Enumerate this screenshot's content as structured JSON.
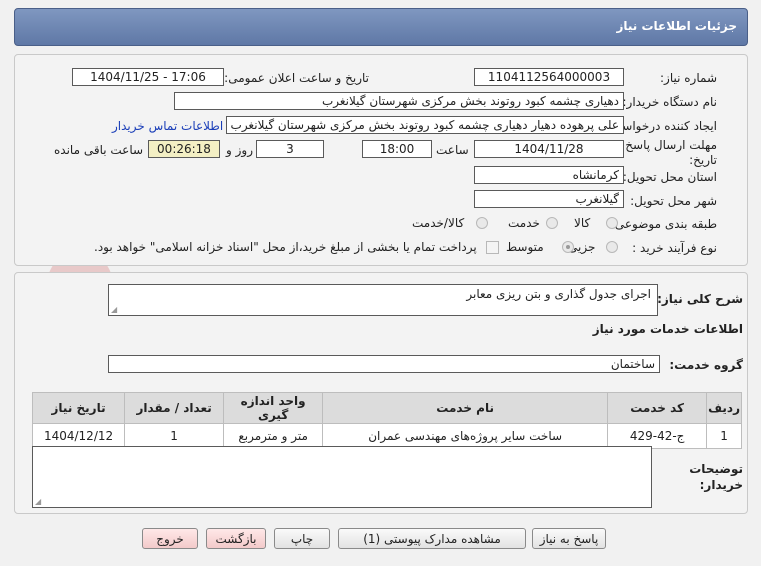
{
  "header": {
    "title": "جزئیات اطلاعات نیاز"
  },
  "form": {
    "need_number_label": "شماره نیاز:",
    "need_number": "1104112564000003",
    "announce_label": "تاریخ و ساعت اعلان عمومی:",
    "announce_value": "1404/11/25 - 17:06",
    "buyer_org_label": "نام دستگاه خریدار:",
    "buyer_org": "دهیاری چشمه کبود روتوند بخش مرکزی شهرستان گیلانغرب",
    "requester_label": "ایجاد کننده درخواست:",
    "requester": "علی پرهوده دهیار دهیاری چشمه کبود روتوند بخش مرکزی شهرستان گیلانغرب",
    "contact_link": "اطلاعات تماس خریدار",
    "deadline_label_1": "مهلت ارسال پاسخ: تا",
    "deadline_label_2": "تاریخ:",
    "deadline_date": "1404/11/28",
    "time_label": "ساعت",
    "deadline_time": "18:00",
    "days_value": "3",
    "days_label": "روز و",
    "remaining_time": "00:26:18",
    "remaining_label": "ساعت باقی مانده",
    "province_label": "استان محل تحویل:",
    "province": "کرمانشاه",
    "city_label": "شهر محل تحویل:",
    "city": "گیلانغرب",
    "category_label": "طبقه بندی موضوعی:",
    "category_options": [
      "کالا",
      "خدمت",
      "کالا/خدمت"
    ],
    "purchase_type_label": "نوع فرآیند خرید :",
    "purchase_options": [
      "جزیی",
      "متوسط"
    ],
    "payment_note": "پرداخت تمام یا بخشی از مبلغ خرید،از محل \"اسناد خزانه اسلامی\" خواهد بود."
  },
  "description": {
    "label": "شرح کلی نیاز:",
    "value": "اجرای جدول گذاری و بتن ریزی معابر"
  },
  "services": {
    "section_title": "اطلاعات خدمات مورد نیاز",
    "group_label": "گروه خدمت:",
    "group_value": "ساختمان",
    "columns": [
      "ردیف",
      "کد خدمت",
      "نام خدمت",
      "واحد اندازه گیری",
      "تعداد / مقدار",
      "تاریخ نیاز"
    ],
    "rows": [
      [
        "1",
        "ج-42-429",
        "ساخت سایر پروژه‌های مهندسی عمران",
        "متر و مترمربع",
        "1",
        "1404/12/12"
      ]
    ]
  },
  "notes": {
    "label_1": "توضیحات",
    "label_2": "خریدار:"
  },
  "buttons": {
    "reply": "پاسخ به نیاز",
    "attachments": "مشاهده مدارک پیوستی (1)",
    "print": "چاپ",
    "back": "بازگشت",
    "exit": "خروج"
  },
  "colors": {
    "header": "#6d86b3",
    "link": "#1a3eb8",
    "remaining_bg": "#f3efc4"
  }
}
